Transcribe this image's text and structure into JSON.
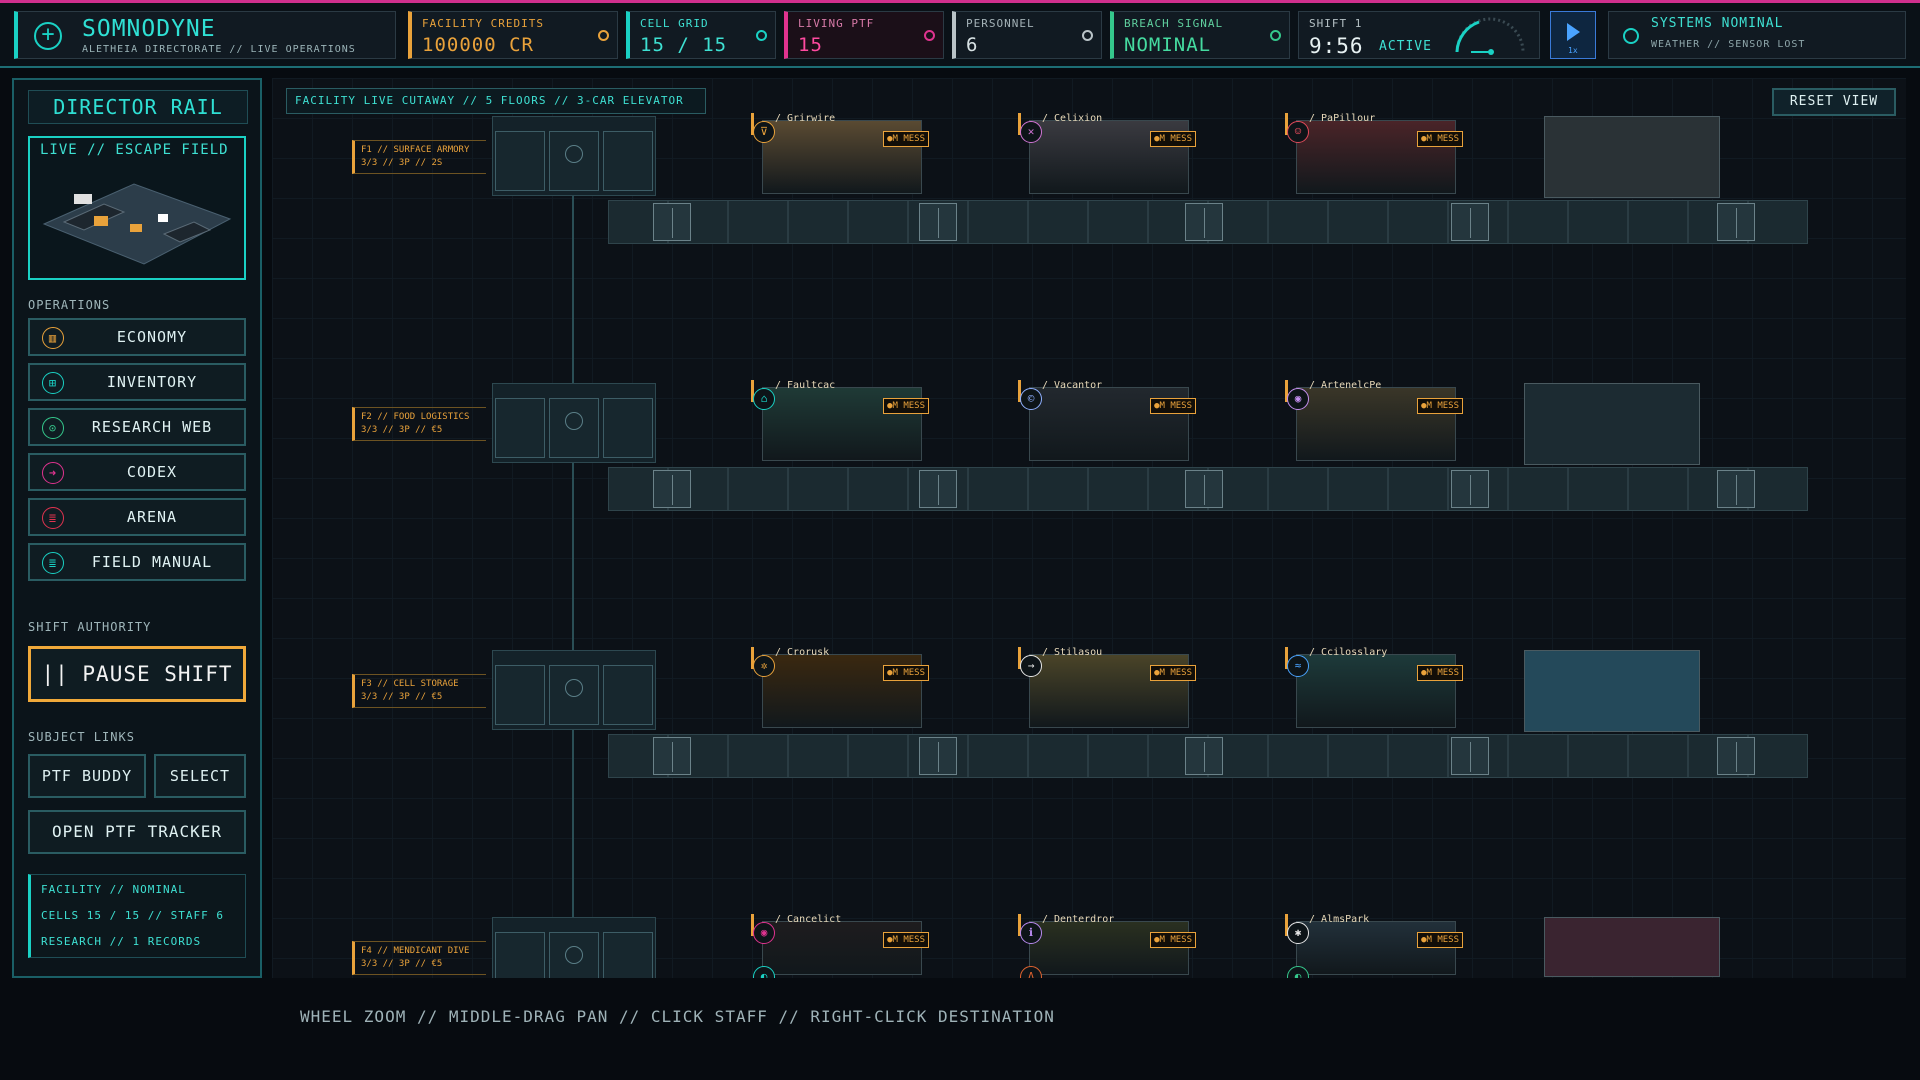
{
  "topbar": {
    "brand": "SOMNODYNE",
    "brand_sub": "ALETHEIA DIRECTORATE // LIVE OPERATIONS",
    "credits_label": "FACILITY CREDITS",
    "credits_value": "100000 CR",
    "cellgrid_label": "CELL GRID",
    "cellgrid_value": "15 / 15",
    "living_label": "LIVING PTF",
    "living_value": "15",
    "personnel_label": "PERSONNEL",
    "personnel_value": "6",
    "breach_label": "BREACH SIGNAL",
    "breach_value": "NOMINAL",
    "shift_label": "SHIFT 1",
    "shift_time": "9:56",
    "shift_state": "ACTIVE",
    "speed": "1x",
    "systems_status": "SYSTEMS NOMINAL",
    "systems_sub": "WEATHER // SENSOR LOST"
  },
  "rail": {
    "title": "DIRECTOR RAIL",
    "live_label": "LIVE // ESCAPE FIELD",
    "operations_label": "OPERATIONS",
    "ops": [
      {
        "label": "ECONOMY",
        "icon": "bar-chart-icon",
        "color": "#e9a23b"
      },
      {
        "label": "INVENTORY",
        "icon": "grid-icon",
        "color": "#1ad1c4"
      },
      {
        "label": "RESEARCH WEB",
        "icon": "magnifier-icon",
        "color": "#35c88c"
      },
      {
        "label": "CODEX",
        "icon": "arrow-icon",
        "color": "#e0338f"
      },
      {
        "label": "ARENA",
        "icon": "document-icon",
        "color": "#e0334f"
      },
      {
        "label": "FIELD MANUAL",
        "icon": "manual-icon",
        "color": "#1ad1c4"
      }
    ],
    "shift_authority_label": "SHIFT AUTHORITY",
    "pause_label": "|| PAUSE SHIFT",
    "subject_links_label": "SUBJECT LINKS",
    "ptf_buddy_label": "PTF BUDDY",
    "select_label": "SELECT",
    "tracker_label": "OPEN PTF TRACKER",
    "status_lines": [
      "FACILITY // NOMINAL",
      "CELLS 15 / 15 // STAFF 6",
      "RESEARCH // 1 RECORDS"
    ]
  },
  "main": {
    "cutaway_label": "FACILITY LIVE CUTAWAY // 5 FLOORS // 3-CAR ELEVATOR",
    "reset_label": "RESET VIEW",
    "mess_label": "●M MESS",
    "floors": [
      {
        "label1": "F1 // SURFACE ARMORY",
        "label2": "3/3 // 3P // 2S",
        "rooms": [
          {
            "name": "/ Grirwire",
            "icon": "⊽",
            "color": "#e9a23b",
            "bg": "#5a4a32"
          },
          {
            "name": "/ Celixion",
            "icon": "✕",
            "color": "#d074d4",
            "bg": "#3a3a40"
          },
          {
            "name": "/ PaPillour",
            "icon": "☺",
            "color": "#e04a5a",
            "bg": "#4a2428"
          }
        ]
      },
      {
        "label1": "F2 // FOOD LOGISTICS",
        "label2": "3/3 // 3P // €5",
        "rooms": [
          {
            "name": "/ Faultcac",
            "icon": "⌂",
            "color": "#1ad1c4",
            "bg": "#1f3a36"
          },
          {
            "name": "/ Vacantor",
            "icon": "©",
            "color": "#8fb0ff",
            "bg": "#22282e"
          },
          {
            "name": "/ ArtenelcPe",
            "icon": "◉",
            "color": "#c58ff0",
            "bg": "#3a3628"
          }
        ]
      },
      {
        "label1": "F3 // CELL STORAGE",
        "label2": "3/3 // 3P // €5",
        "rooms": [
          {
            "name": "/ Crorusk",
            "icon": "✲",
            "color": "#e9a23b",
            "bg": "#3a2810"
          },
          {
            "name": "/ Stilasou",
            "icon": "→",
            "color": "#e8e8e8",
            "bg": "#4a4428"
          },
          {
            "name": "/ Ccilosslary",
            "icon": "≈",
            "color": "#4aa3ff",
            "bg": "#1d3a3a"
          }
        ]
      },
      {
        "label1": "F4 // MENDICANT DIVE",
        "label2": "3/3 // 3P // €5",
        "rooms": [
          {
            "name": "/ Cancelict",
            "icon": "◉",
            "color": "#e0338f",
            "bg": "#1e1c1e",
            "sub": "◐",
            "subcolor": "#1ad1c4"
          },
          {
            "name": "/ Denterdror",
            "icon": "ℹ",
            "color": "#b98af0",
            "bg": "#2a3020",
            "sub": "Λ",
            "subcolor": "#e0632f"
          },
          {
            "name": "/ AlmsPark",
            "icon": "✱",
            "color": "#e8e8e8",
            "bg": "#22303a",
            "sub": "◐",
            "subcolor": "#35c88c"
          }
        ]
      }
    ]
  },
  "hint": "WHEEL ZOOM // MIDDLE-DRAG PAN // CLICK STAFF // RIGHT-CLICK DESTINATION"
}
